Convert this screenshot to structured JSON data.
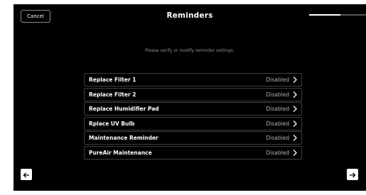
{
  "header": {
    "cancel_label": "Cancel",
    "title": "Reminders",
    "progress_fraction": 0.55
  },
  "main": {
    "subtitle": "Please verify or modify reminder settings.",
    "reminders": [
      {
        "label": "Replace Filter 1",
        "status": "Disabled"
      },
      {
        "label": "Replace Filter 2",
        "status": "Disabled"
      },
      {
        "label": "Replace Humidifier Pad",
        "status": "Disabled"
      },
      {
        "label": "Rplace UV Bulb",
        "status": "Disabled"
      },
      {
        "label": "Maintenance Reminder",
        "status": "Disabled"
      },
      {
        "label": "PureAir Maintenance",
        "status": "Disabled"
      }
    ]
  },
  "footer": {
    "back_icon": "arrow-left-icon",
    "next_icon": "arrow-right-icon"
  },
  "colors": {
    "background": "#000000",
    "text": "#ffffff",
    "muted": "#8d8d8d",
    "row_border": "#3f3f3f"
  }
}
